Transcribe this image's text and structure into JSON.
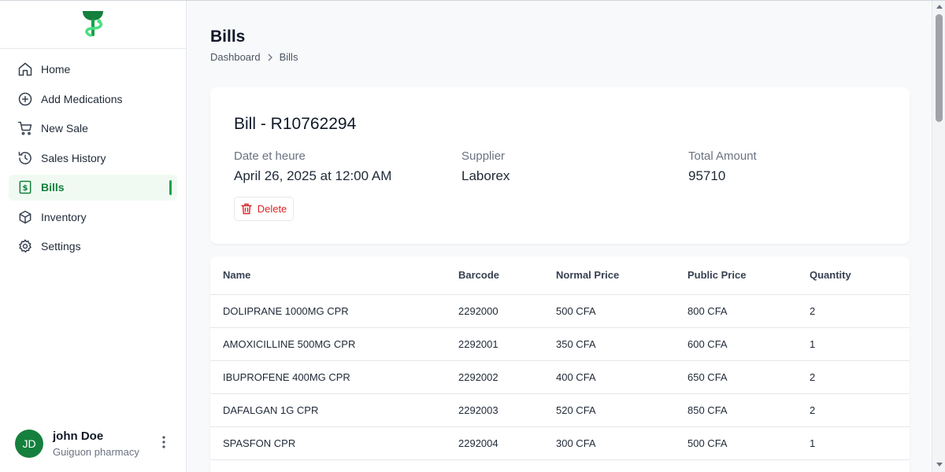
{
  "sidebar": {
    "items": [
      {
        "label": "Home",
        "icon": "home-icon"
      },
      {
        "label": "Add Medications",
        "icon": "plus-circle-icon"
      },
      {
        "label": "New Sale",
        "icon": "cart-icon"
      },
      {
        "label": "Sales History",
        "icon": "history-icon"
      },
      {
        "label": "Bills",
        "icon": "bill-icon",
        "active": true
      },
      {
        "label": "Inventory",
        "icon": "box-icon"
      },
      {
        "label": "Settings",
        "icon": "gear-icon"
      }
    ],
    "user": {
      "initials": "JD",
      "name": "john Doe",
      "org": "Guiguon pharmacy"
    }
  },
  "header": {
    "title": "Bills",
    "breadcrumb": [
      "Dashboard",
      "Bills"
    ]
  },
  "bill": {
    "title": "Bill - R10762294",
    "date_label": "Date et heure",
    "date_value": "April 26, 2025 at 12:00 AM",
    "supplier_label": "Supplier",
    "supplier_value": "Laborex",
    "total_label": "Total Amount",
    "total_value": "95710",
    "delete_label": "Delete"
  },
  "table": {
    "headers": [
      "Name",
      "Barcode",
      "Normal Price",
      "Public Price",
      "Quantity"
    ],
    "rows": [
      [
        "DOLIPRANE 1000MG CPR",
        "2292000",
        "500 CFA",
        "800 CFA",
        "2"
      ],
      [
        "AMOXICILLINE 500MG CPR",
        "2292001",
        "350 CFA",
        "600 CFA",
        "1"
      ],
      [
        "IBUPROFENE 400MG CPR",
        "2292002",
        "400 CFA",
        "650 CFA",
        "2"
      ],
      [
        "DAFALGAN 1G CPR",
        "2292003",
        "520 CFA",
        "850 CFA",
        "2"
      ],
      [
        "SPASFON CPR",
        "2292004",
        "300 CFA",
        "500 CFA",
        "1"
      ]
    ]
  },
  "colors": {
    "accent": "#16a34a",
    "danger": "#dc2626"
  }
}
